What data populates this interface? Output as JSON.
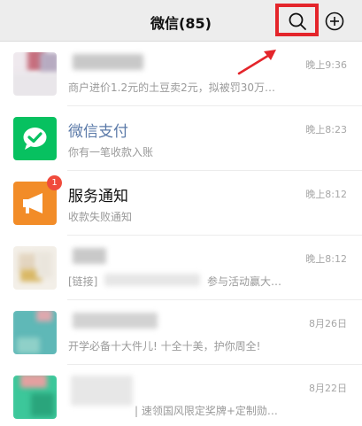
{
  "header": {
    "title": "微信(85)",
    "icons": [
      "search-icon",
      "add-icon"
    ],
    "highlight_color": "#e4252b"
  },
  "chats": [
    {
      "name": "",
      "preview": "商户进价1.2元的土豆卖2元，拟被罚30万…",
      "time": "晚上9:36"
    },
    {
      "name": "微信支付",
      "preview": "你有一笔收款入账",
      "time": "晚上8:23",
      "icon": "check-speech-bubble-icon",
      "icon_color": "#07c160"
    },
    {
      "name": "服务通知",
      "preview": "收款失败通知",
      "time": "晚上8:12",
      "badge": "1",
      "icon": "megaphone-icon",
      "icon_color": "#f28c28"
    },
    {
      "name": "",
      "preview_left": "[链接]",
      "preview_right": "参与活动赢大…",
      "time": "晚上8:12"
    },
    {
      "name": "",
      "preview": "开学必备十大件儿! 十全十美，护你周全!",
      "time": "8月26日"
    },
    {
      "name": "",
      "preview": "| 速领国风限定奖牌+定制勋…",
      "time": "8月22日"
    }
  ]
}
